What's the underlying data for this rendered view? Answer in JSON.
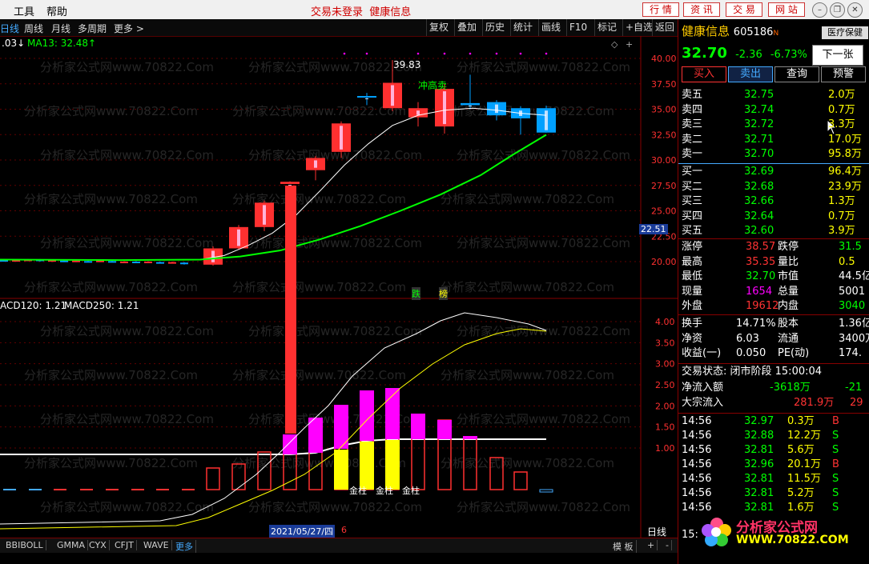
{
  "menu": {
    "tools": "工具",
    "help": "帮助",
    "status": "交易未登录",
    "stock_title": "健康信息",
    "buttons": [
      "行 情",
      "资 讯",
      "交 易",
      "网 站"
    ]
  },
  "toolbar": {
    "left": [
      "日线",
      "周线",
      "月线",
      "多周期",
      "更多 >"
    ],
    "right": [
      "复权",
      "叠加",
      "历史",
      "统计",
      "画线",
      "F10",
      "标记",
      "+自选",
      "返回"
    ]
  },
  "kline": {
    "ma_label_a": ".03↓",
    "ma_label_b": "MA13: 32.48↑",
    "max_label": "39.83",
    "annot_top": "冲高卖",
    "annot_bottom_a": "跌",
    "annot_bottom_b": "榜",
    "current_price_tag": "22.51",
    "yticks": [
      "40.00",
      "37.50",
      "35.00",
      "32.50",
      "30.00",
      "27.50",
      "25.00",
      "22.50",
      "20.00"
    ]
  },
  "macd": {
    "label_a": "ACD120: 1.21",
    "label_b": "MACD250: 1.21",
    "gold_labels": [
      "金柱",
      "金柱",
      "金柱"
    ],
    "yticks": [
      "4.00",
      "3.50",
      "3.00",
      "2.50",
      "2.00",
      "1.50",
      "1.00"
    ]
  },
  "date_tag": "2021/05/27/四",
  "date_num": "6",
  "period_label": "日线",
  "bottom_tabs": [
    "BBIBOLL",
    "GMMA",
    "CYX",
    "CFJT",
    "WAVE",
    "更多"
  ],
  "template_btn": "模 板",
  "quote": {
    "name": "健康信息",
    "code": "605186",
    "sector": "医疗保健",
    "price": "32.70",
    "change": "-2.36",
    "pct": "-6.73%",
    "next": "下一张",
    "actions": [
      "买入",
      "卖出",
      "查询",
      "预警"
    ],
    "asks": [
      {
        "label": "卖五",
        "price": "32.75",
        "vol": "2.0万"
      },
      {
        "label": "卖四",
        "price": "32.74",
        "vol": "0.7万"
      },
      {
        "label": "卖三",
        "price": "32.72",
        "vol": "3.3万"
      },
      {
        "label": "卖二",
        "price": "32.71",
        "vol": "17.0万"
      },
      {
        "label": "卖一",
        "price": "32.70",
        "vol": "95.8万"
      }
    ],
    "bids": [
      {
        "label": "买一",
        "price": "32.69",
        "vol": "96.4万"
      },
      {
        "label": "买二",
        "price": "32.68",
        "vol": "23.9万"
      },
      {
        "label": "买三",
        "price": "32.66",
        "vol": "1.3万"
      },
      {
        "label": "买四",
        "price": "32.64",
        "vol": "0.7万"
      },
      {
        "label": "买五",
        "price": "32.60",
        "vol": "3.9万"
      }
    ],
    "stats": [
      {
        "k1": "涨停",
        "v1": "38.57",
        "k2": "跌停",
        "v2": "31.5"
      },
      {
        "k1": "最高",
        "v1": "35.35",
        "k2": "量比",
        "v2": "0.5"
      },
      {
        "k1": "最低",
        "v1": "32.70",
        "k2": "市值",
        "v2": "44.5亿"
      },
      {
        "k1": "现量",
        "v1": "1654",
        "k2": "总量",
        "v2": "5001"
      },
      {
        "k1": "外盘",
        "v1": "19612",
        "k2": "内盘",
        "v2": "3040"
      }
    ],
    "fund": [
      {
        "k1": "换手",
        "v1": "14.71%",
        "k2": "股本",
        "v2": "1.36亿"
      },
      {
        "k1": "净资",
        "v1": "6.03",
        "k2": "流通",
        "v2": "3400万"
      },
      {
        "k1": "收益(一)",
        "v1": "0.050",
        "k2": "PE(动)",
        "v2": "174."
      }
    ],
    "trade_state": "交易状态: 闭市阶段 15:00:04",
    "net_inflow": {
      "label": "净流入额",
      "v1": "-3618万",
      "v2": "-21"
    },
    "block_inflow": {
      "label": "大宗流入",
      "v1": "281.9万",
      "v2": "29"
    },
    "ticks": [
      {
        "t": "14:56",
        "p": "32.97",
        "v": "0.3万",
        "s": "B"
      },
      {
        "t": "14:56",
        "p": "32.88",
        "v": "12.2万",
        "s": "S"
      },
      {
        "t": "14:56",
        "p": "32.81",
        "v": "5.6万",
        "s": "S"
      },
      {
        "t": "14:56",
        "p": "32.96",
        "v": "20.1万",
        "s": "B"
      },
      {
        "t": "14:56",
        "p": "32.81",
        "v": "11.5万",
        "s": "S"
      },
      {
        "t": "14:56",
        "p": "32.81",
        "v": "5.2万",
        "s": "S"
      },
      {
        "t": "14:56",
        "p": "32.81",
        "v": "1.6万",
        "s": "S"
      }
    ]
  },
  "watermark": "分析家公式网www.70822.Com",
  "logo": {
    "title": "分析家公式网",
    "url": "WWW.70822.COM"
  },
  "colors": {
    "up": "#ff3030",
    "down": "#00a0ff",
    "green": "#00ff00",
    "yellow": "#ffff00",
    "magenta": "#ff00ff",
    "white": "#ffffff",
    "grid": "#600000"
  }
}
